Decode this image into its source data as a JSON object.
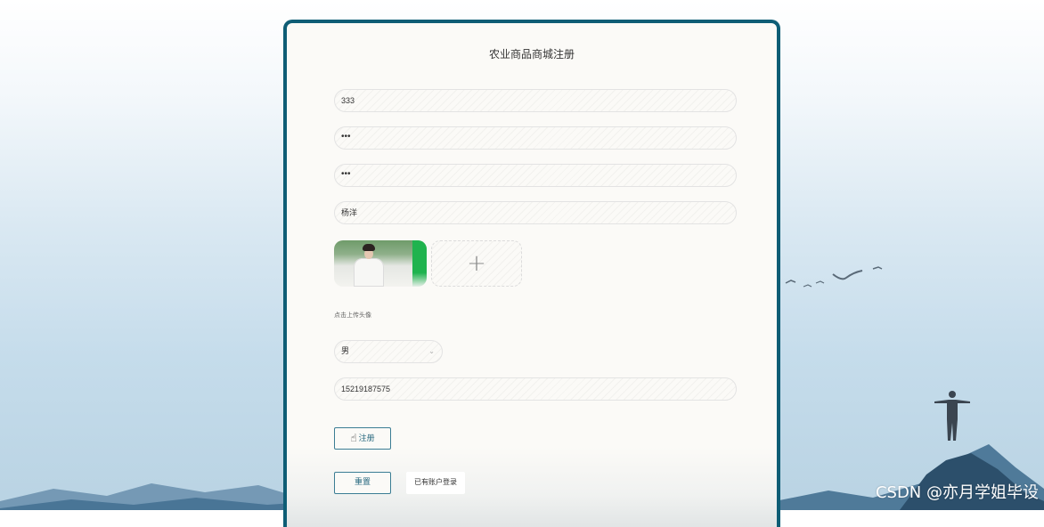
{
  "register_form": {
    "title": "农业商品商城注册",
    "account_value": "333",
    "password_value": "•••",
    "confirm_password_value": "•••",
    "name_value": "杨洋",
    "upload_hint": "点击上传头像",
    "upload_plus": "+",
    "gender_value": "男",
    "phone_value": "15219187575",
    "register_label": "注册",
    "reset_label": "重置",
    "login_link_label": "已有账户登录"
  },
  "watermark": "CSDN @亦月学姐毕设",
  "colors": {
    "card_border": "#0e5d75",
    "button_border": "#3b7d94",
    "card_bg": "#fbfaf7"
  }
}
